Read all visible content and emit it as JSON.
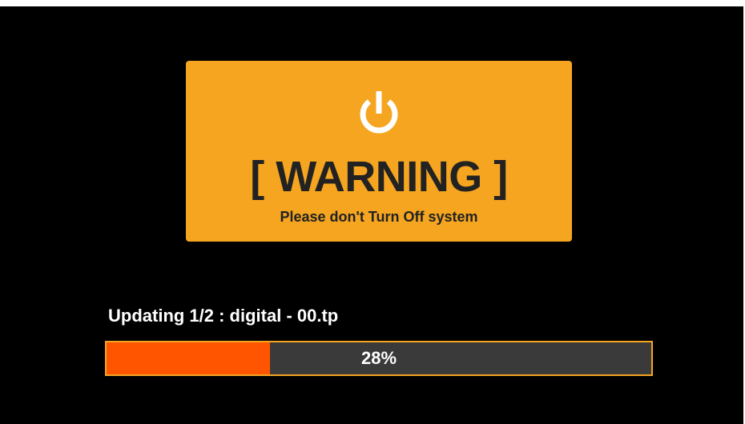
{
  "warning": {
    "icon": "power-icon",
    "title": "[ WARNING ]",
    "subtitle": "Please don't Turn Off system"
  },
  "update": {
    "status": "Updating 1/2 : digital - 00.tp",
    "progress_label": "28%",
    "progress_fraction": 0.3
  },
  "colors": {
    "background": "#000000",
    "panel": "#f5a520",
    "fill": "#ff5500",
    "track": "#3a3a3a",
    "text_dark": "#222222",
    "text_light": "#ffffff"
  }
}
